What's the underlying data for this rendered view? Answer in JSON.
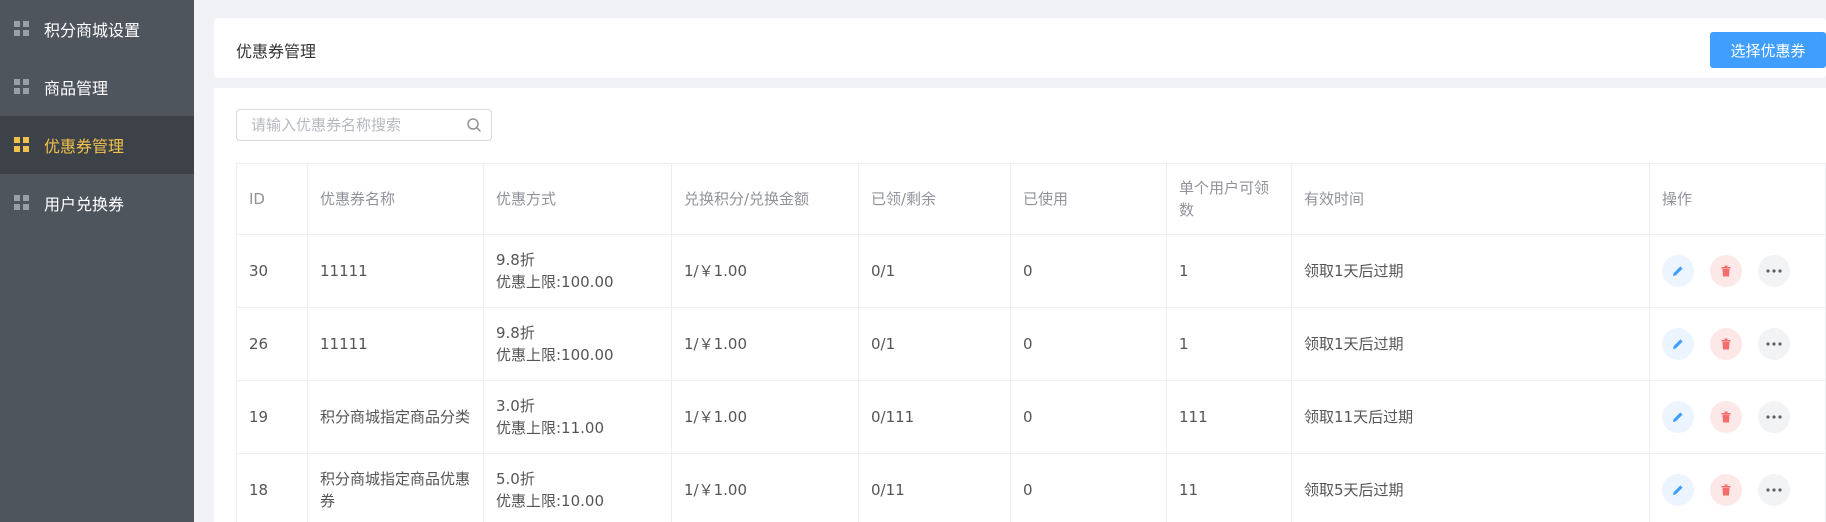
{
  "sidebar": {
    "items": [
      {
        "label": "积分商城设置",
        "active": false
      },
      {
        "label": "商品管理",
        "active": false
      },
      {
        "label": "优惠券管理",
        "active": true
      },
      {
        "label": "用户兑换券",
        "active": false
      }
    ]
  },
  "header": {
    "title": "优惠券管理",
    "select_button": "选择优惠券"
  },
  "search": {
    "placeholder": "请输入优惠券名称搜索",
    "value": ""
  },
  "table": {
    "columns": [
      "ID",
      "优惠券名称",
      "优惠方式",
      "兑换积分/兑换金额",
      "已领/剩余",
      "已使用",
      "单个用户可领数",
      "有效时间",
      "操作"
    ],
    "rows": [
      {
        "id": "30",
        "name": "11111",
        "discount": "9.8折",
        "limit": "优惠上限:100.00",
        "exchange": "1/￥1.00",
        "claimed": "0/1",
        "used": "0",
        "per_user": "1",
        "valid": "领取1天后过期"
      },
      {
        "id": "26",
        "name": "11111",
        "discount": "9.8折",
        "limit": "优惠上限:100.00",
        "exchange": "1/￥1.00",
        "claimed": "0/1",
        "used": "0",
        "per_user": "1",
        "valid": "领取1天后过期"
      },
      {
        "id": "19",
        "name": "积分商城指定商品分类",
        "discount": "3.0折",
        "limit": "优惠上限:11.00",
        "exchange": "1/￥1.00",
        "claimed": "0/111",
        "used": "0",
        "per_user": "111",
        "valid": "领取11天后过期"
      },
      {
        "id": "18",
        "name": "积分商城指定商品优惠券",
        "discount": "5.0折",
        "limit": "优惠上限:10.00",
        "exchange": "1/￥1.00",
        "claimed": "0/11",
        "used": "0",
        "per_user": "11",
        "valid": "领取5天后过期"
      }
    ]
  },
  "colors": {
    "sidebar_bg": "#4f555d",
    "sidebar_active_bg": "#3d4249",
    "sidebar_active_text": "#f0c14b",
    "primary": "#409eff",
    "danger": "#f56c6c"
  },
  "icons": {
    "sidebar": "grid-icon",
    "search": "search-icon",
    "edit": "pencil-icon",
    "delete": "trash-icon",
    "more": "more-icon"
  }
}
